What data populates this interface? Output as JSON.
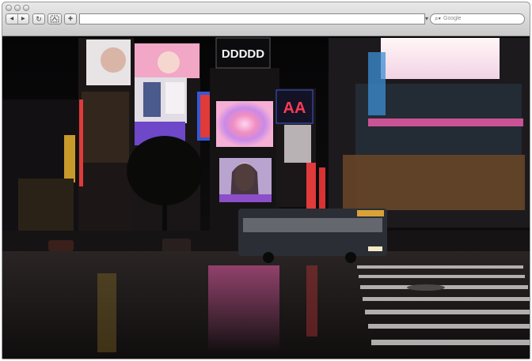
{
  "window": {
    "title": ""
  },
  "toolbar": {
    "back_glyph": "◀",
    "forward_glyph": "▶",
    "reload_glyph": "↻",
    "add_glyph": "+",
    "url_value": "",
    "search_placeholder": "Google"
  },
  "icons": {
    "back": "back-arrow-icon",
    "forward": "forward-arrow-icon",
    "reload": "reload-icon",
    "snippet": "web-snippet-icon",
    "add": "plus-icon",
    "search": "magnifier-icon"
  },
  "signs": {
    "block_sign": "DDDDD",
    "red_sign": "AA"
  },
  "colors": {
    "toolbar_top": "#e9e9e9",
    "toolbar_bottom": "#c9c9c9",
    "night_sky": "#0b0a0c",
    "road": "#1a1718",
    "bus": "#2b2e34",
    "neon_pink": "#e85aa8",
    "neon_red": "#e03a3a"
  }
}
